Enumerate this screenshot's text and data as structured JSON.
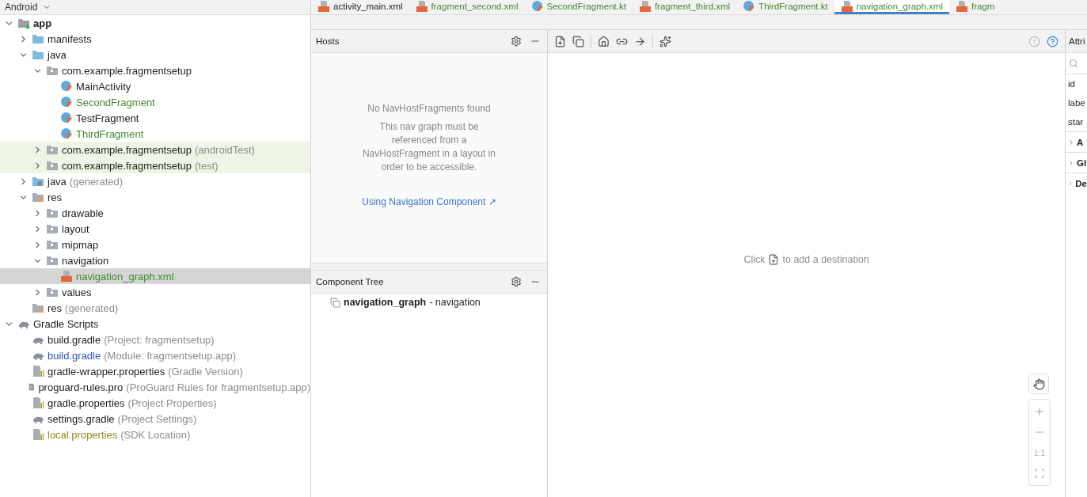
{
  "project_view": {
    "title": "Android",
    "tree": [
      {
        "label": "app",
        "kind": "module",
        "bold": true,
        "expanded": true,
        "children": [
          {
            "label": "manifests",
            "kind": "folder",
            "expanded": false
          },
          {
            "label": "java",
            "kind": "folder",
            "expanded": true,
            "children": [
              {
                "label": "com.example.fragmentsetup",
                "kind": "package",
                "expanded": true,
                "children": [
                  {
                    "label": "MainActivity",
                    "kind": "class"
                  },
                  {
                    "label": "SecondFragment",
                    "kind": "class",
                    "color": "#3f8a2f"
                  },
                  {
                    "label": "TestFragment",
                    "kind": "class"
                  },
                  {
                    "label": "ThirdFragment",
                    "kind": "class",
                    "color": "#3f8a2f"
                  }
                ]
              },
              {
                "label": "com.example.fragmentsetup",
                "suffix": "(androidTest)",
                "kind": "package",
                "expanded": false,
                "highlighted": true
              },
              {
                "label": "com.example.fragmentsetup",
                "suffix": "(test)",
                "kind": "package",
                "expanded": false,
                "highlighted": true
              }
            ]
          },
          {
            "label": "java",
            "suffix": "(generated)",
            "kind": "java-gen",
            "expanded": false
          },
          {
            "label": "res",
            "kind": "res",
            "expanded": true,
            "children": [
              {
                "label": "drawable",
                "kind": "package",
                "expanded": false
              },
              {
                "label": "layout",
                "kind": "package",
                "expanded": false
              },
              {
                "label": "mipmap",
                "kind": "package",
                "expanded": false
              },
              {
                "label": "navigation",
                "kind": "package",
                "expanded": true,
                "children": [
                  {
                    "label": "navigation_graph.xml",
                    "kind": "xml",
                    "color": "#3f8a2f",
                    "selected": true
                  }
                ]
              },
              {
                "label": "values",
                "kind": "package",
                "expanded": false
              }
            ]
          },
          {
            "label": "res",
            "suffix": "(generated)",
            "kind": "res"
          }
        ]
      },
      {
        "label": "Gradle Scripts",
        "kind": "gradle",
        "expanded": true,
        "children": [
          {
            "label": "build.gradle",
            "suffix": "(Project: fragmentsetup)",
            "kind": "gradle"
          },
          {
            "label": "build.gradle",
            "suffix": "(Module: fragmentsetup.app)",
            "kind": "gradle",
            "color": "#2f54b5"
          },
          {
            "label": "gradle-wrapper.properties",
            "suffix": "(Gradle Version)",
            "kind": "properties"
          },
          {
            "label": "proguard-rules.pro",
            "suffix": "(ProGuard Rules for fragmentsetup.app)",
            "kind": "file"
          },
          {
            "label": "gradle.properties",
            "suffix": "(Project Properties)",
            "kind": "properties"
          },
          {
            "label": "settings.gradle",
            "suffix": "(Project Settings)",
            "kind": "gradle"
          },
          {
            "label": "local.properties",
            "suffix": "(SDK Location)",
            "kind": "properties",
            "color": "#8a8a20"
          }
        ]
      }
    ]
  },
  "editor_tabs": [
    {
      "label": "activity_main.xml",
      "kind": "xml",
      "selected": false
    },
    {
      "label": "fragment_second.xml",
      "kind": "xml",
      "selected": false,
      "color": "#3f8a2f"
    },
    {
      "label": "SecondFragment.kt",
      "kind": "class",
      "selected": false,
      "color": "#3f8a2f"
    },
    {
      "label": "fragment_third.xml",
      "kind": "xml",
      "selected": false,
      "color": "#3f8a2f"
    },
    {
      "label": "ThirdFragment.kt",
      "kind": "class",
      "selected": false,
      "color": "#3f8a2f"
    },
    {
      "label": "navigation_graph.xml",
      "kind": "xml",
      "selected": true,
      "color": "#3f8a2f"
    },
    {
      "label": "fragm",
      "kind": "xml",
      "selected": false,
      "color": "#3f8a2f"
    }
  ],
  "hosts": {
    "title": "Hosts",
    "heading": "No NavHostFragments found",
    "message": "This nav graph must be referenced from a NavHostFragment in a layout in order to be accessible.",
    "link": "Using Navigation Component ↗"
  },
  "component_tree": {
    "title": "Component Tree",
    "items": [
      {
        "name": "navigation_graph",
        "type": "- navigation"
      }
    ]
  },
  "canvas": {
    "hint_before": "Click",
    "hint_after": "to add a destination",
    "zoom_reset": "1:1"
  },
  "attributes": {
    "title": "Attri",
    "fields": [
      "id",
      "labe",
      "star"
    ],
    "sections": [
      "A",
      "Gl",
      "De"
    ]
  }
}
